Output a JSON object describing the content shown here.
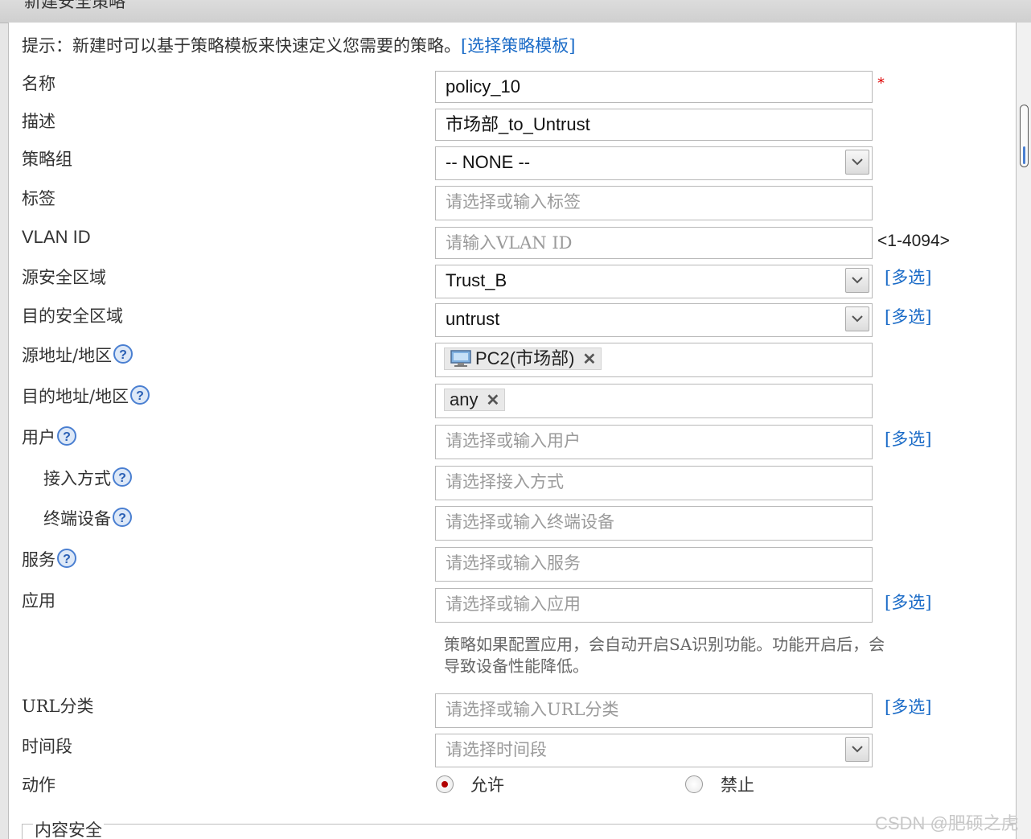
{
  "window": {
    "title": "新建安全策略"
  },
  "hint": {
    "text": "提示：新建时可以基于策略模板来快速定义您需要的策略。",
    "link": "[选择策略模板]"
  },
  "form": {
    "name": {
      "label": "名称",
      "value": "policy_10",
      "required_mark": "*"
    },
    "description": {
      "label": "描述",
      "value": "市场部_to_Untrust"
    },
    "policy_group": {
      "label": "策略组",
      "value": "-- NONE --"
    },
    "tag": {
      "label": "标签",
      "placeholder": "请选择或输入标签"
    },
    "vlan_id": {
      "label": "VLAN ID",
      "placeholder": "请输入VLAN ID",
      "range": "<1-4094>"
    },
    "source_zone": {
      "label": "源安全区域",
      "value": "Trust_B",
      "multi": "[多选]"
    },
    "dest_zone": {
      "label": "目的安全区域",
      "value": "untrust",
      "multi": "[多选]"
    },
    "source_address": {
      "label": "源地址/地区",
      "tag": "PC2(市场部)"
    },
    "dest_address": {
      "label": "目的地址/地区",
      "tag": "any"
    },
    "user": {
      "label": "用户",
      "placeholder": "请选择或输入用户",
      "multi": "[多选]"
    },
    "access_mode": {
      "label": "接入方式",
      "placeholder": "请选择接入方式"
    },
    "terminal_device": {
      "label": "终端设备",
      "placeholder": "请选择或输入终端设备"
    },
    "service": {
      "label": "服务",
      "placeholder": "请选择或输入服务"
    },
    "application": {
      "label": "应用",
      "placeholder": "请选择或输入应用",
      "multi": "[多选]",
      "note": "策略如果配置应用，会自动开启SA识别功能。功能开启后，会导致设备性能降低。"
    },
    "url_category": {
      "label": "URL分类",
      "placeholder": "请选择或输入URL分类",
      "multi": "[多选]"
    },
    "time_range": {
      "label": "时间段",
      "placeholder": "请选择时间段"
    },
    "action": {
      "label": "动作",
      "permit": "允许",
      "deny": "禁止",
      "selected": "允许"
    }
  },
  "content_security": {
    "legend": "内容安全"
  },
  "watermark": "CSDN @肥硕之虎",
  "colors": {
    "link": "#1a6bc7",
    "required": "#dd0000",
    "radio_selected": "#b10000"
  }
}
